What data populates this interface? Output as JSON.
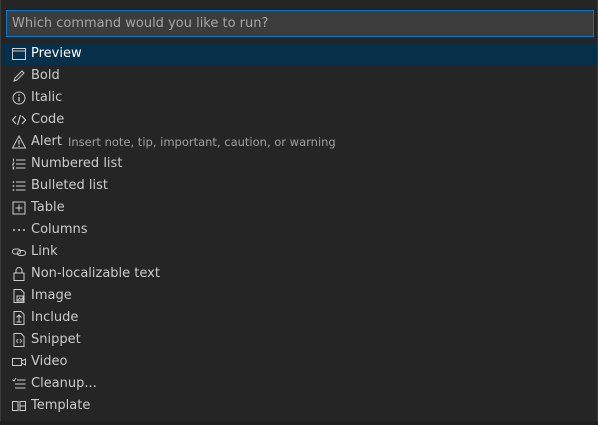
{
  "search": {
    "placeholder": "Which command would you like to run?",
    "value": ""
  },
  "commands": [
    {
      "label": "Preview",
      "icon": "preview-icon",
      "description": "",
      "active": true
    },
    {
      "label": "Bold",
      "icon": "pencil-icon",
      "description": ""
    },
    {
      "label": "Italic",
      "icon": "info-icon",
      "description": ""
    },
    {
      "label": "Code",
      "icon": "code-icon",
      "description": ""
    },
    {
      "label": "Alert",
      "icon": "warning-icon",
      "description": "Insert note, tip, important, caution, or warning"
    },
    {
      "label": "Numbered list",
      "icon": "numbered-list-icon",
      "description": ""
    },
    {
      "label": "Bulleted list",
      "icon": "bulleted-list-icon",
      "description": ""
    },
    {
      "label": "Table",
      "icon": "table-icon",
      "description": ""
    },
    {
      "label": "Columns",
      "icon": "ellipsis-icon",
      "description": ""
    },
    {
      "label": "Link",
      "icon": "link-icon",
      "description": ""
    },
    {
      "label": "Non-localizable text",
      "icon": "lock-icon",
      "description": ""
    },
    {
      "label": "Image",
      "icon": "image-icon",
      "description": ""
    },
    {
      "label": "Include",
      "icon": "include-icon",
      "description": ""
    },
    {
      "label": "Snippet",
      "icon": "snippet-icon",
      "description": ""
    },
    {
      "label": "Video",
      "icon": "video-icon",
      "description": ""
    },
    {
      "label": "Cleanup...",
      "icon": "cleanup-icon",
      "description": ""
    },
    {
      "label": "Template",
      "icon": "template-icon",
      "description": ""
    }
  ],
  "colors": {
    "background": "#252526",
    "input_background": "#3c3c3c",
    "focus_border": "#007acc",
    "active_row": "#062f4a",
    "text": "#cccccc",
    "description": "#a0a0a0"
  }
}
